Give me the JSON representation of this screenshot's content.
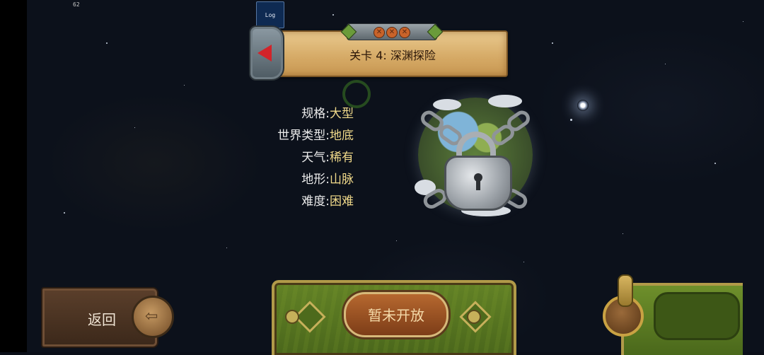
{
  "debug": {
    "fps": "62",
    "log_label": "Log"
  },
  "level": {
    "title": "关卡 4: 深渊探险"
  },
  "info": [
    {
      "label": "规格:",
      "value": "大型"
    },
    {
      "label": "世界类型:",
      "value": "地底"
    },
    {
      "label": "天气:",
      "value": "稀有"
    },
    {
      "label": "地形:",
      "value": "山脉"
    },
    {
      "label": "难度:",
      "value": "困难"
    }
  ],
  "buttons": {
    "back_label": "返回",
    "start_label": "暂未开放"
  },
  "colors": {
    "info_value": "#f0d98a",
    "info_label": "#ececec",
    "prev_arrow": "#d2242a"
  }
}
